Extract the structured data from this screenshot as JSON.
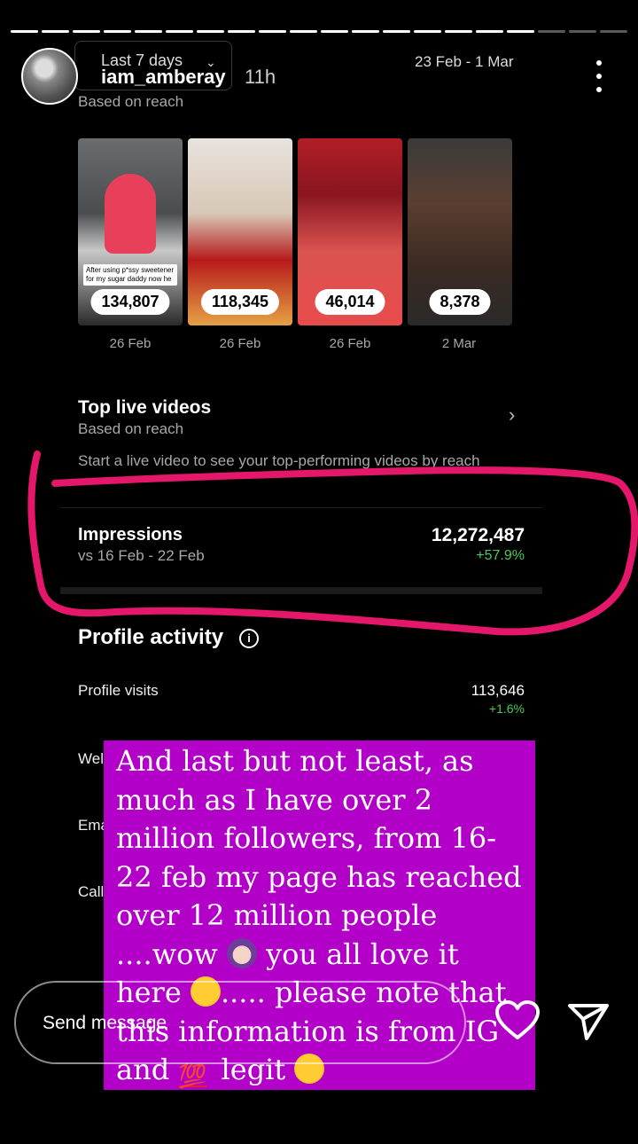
{
  "story": {
    "username": "iam_amberay",
    "time_ago": "11h",
    "segments_total": 20,
    "segments_viewed": 17
  },
  "insights": {
    "period_label": "Last 7 days",
    "date_range": "23 Feb - 1 Mar",
    "basis": "Based on reach",
    "top_videos": [
      {
        "count": "134,807",
        "date": "26 Feb",
        "caption": "After using p*ssy sweetener for my sugar daddy now he"
      },
      {
        "count": "118,345",
        "date": "26 Feb"
      },
      {
        "count": "46,014",
        "date": "26 Feb"
      },
      {
        "count": "8,378",
        "date": "2 Mar"
      }
    ],
    "live": {
      "title": "Top live videos",
      "subtitle": "Based on reach",
      "hint": "Start a live video to see your top-performing videos by reach"
    },
    "impressions": {
      "title": "Impressions",
      "compare": "vs 16 Feb - 22 Feb",
      "value": "12,272,487",
      "change": "+57.9%"
    },
    "profile_activity": {
      "title": "Profile activity",
      "info_icon": "i",
      "visits_label": "Profile visits",
      "visits_value": "113,646",
      "visits_change": "+1.6%",
      "row2_label": "Wel",
      "row3_label": "Ema",
      "row4_label": "Call"
    }
  },
  "overlay": {
    "text_1": "And last but not least, as much as I have over 2 million followers, from 16-22 feb my page has reached over 12 million people ....wow ",
    "text_2": " you all love it here ",
    "text_3": "..... please note that this information is from IG and ",
    "text_4": " legit ",
    "emoji_100": "💯"
  },
  "reply": {
    "placeholder": "Send message"
  },
  "colors": {
    "background": "#000000",
    "overlay": "#b200c8",
    "scribble": "#e5176a",
    "positive": "#4cc95c"
  }
}
